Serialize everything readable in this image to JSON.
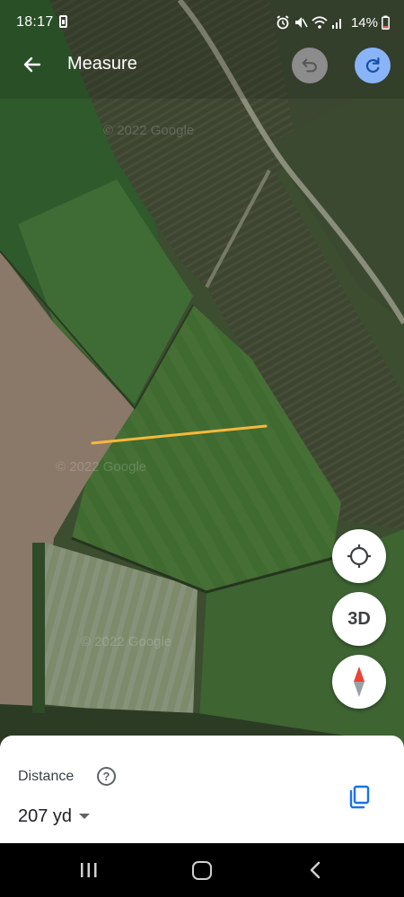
{
  "status_bar": {
    "time": "18:17",
    "battery_percent": "14%",
    "icons": [
      "sim-icon",
      "alarm-icon",
      "mute-icon",
      "wifi-icon",
      "signal-icon",
      "battery-icon"
    ]
  },
  "header": {
    "title": "Measure",
    "back_icon": "arrow-back-icon",
    "undo_icon": "undo-icon",
    "redo_icon": "redo-icon"
  },
  "map": {
    "watermark": "© 2022 Google",
    "measure_line_color": "#f6b93b"
  },
  "controls": {
    "location_icon": "my-location-icon",
    "three_d_label": "3D",
    "compass_icon": "compass-icon"
  },
  "panel": {
    "label": "Distance",
    "help_glyph": "?",
    "distance_value": "207 yd",
    "copy_icon": "copy-icon"
  },
  "colors": {
    "accent_blue": "#8ab4f8",
    "copy_blue": "#1a73e8",
    "compass_red": "#ea4335"
  }
}
